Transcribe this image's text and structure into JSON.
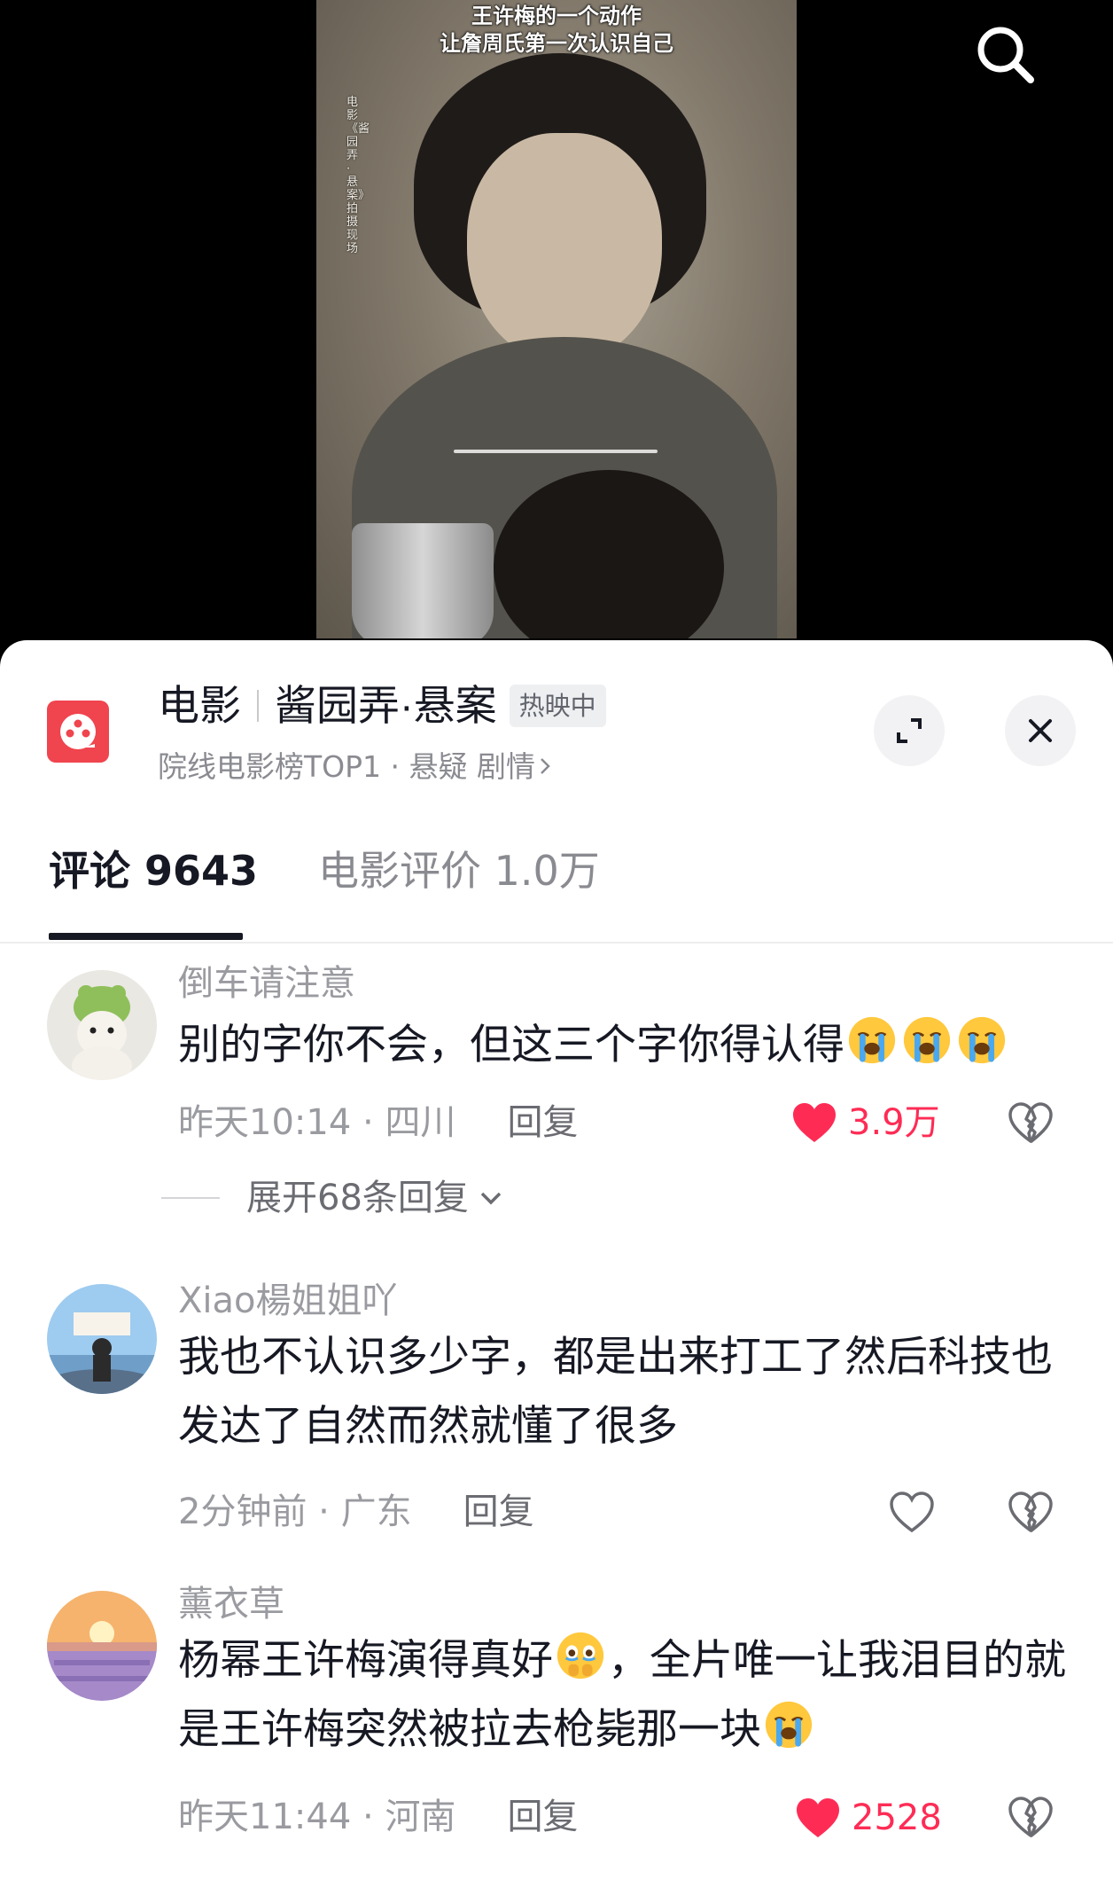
{
  "video": {
    "caption_line1": "王许梅的一个动作",
    "caption_line2": "让詹周氏第一次认识自己",
    "side_text": "电影《酱园弄·悬案》拍摄现场"
  },
  "movie": {
    "category": "电影",
    "name": "酱园弄·悬案",
    "badge": "热映中",
    "subtitle": "院线电影榜TOP1 · 悬疑 剧情",
    "logo_color": "#F0444E"
  },
  "tabs": {
    "comments": "评论 9643",
    "reviews": "电影评价 1.0万"
  },
  "comments": [
    {
      "user": "倒车请注意",
      "text": "别的字你不会，但这三个字你得认得",
      "emojis": [
        "crying-face",
        "crying-face",
        "crying-face"
      ],
      "time": "昨天10:14",
      "location": "四川",
      "reply_label": "回复",
      "likes": "3.9万",
      "liked": true,
      "expand_label": "展开68条回复"
    },
    {
      "user": "Xiao楊姐姐吖",
      "text": "我也不认识多少字，都是出来打工了然后科技也发达了自然而然就懂了很多",
      "time": "2分钟前",
      "location": "广东",
      "reply_label": "回复",
      "liked": false
    },
    {
      "user": "薰衣草",
      "text_part1": "杨幂王许梅演得真好",
      "text_part2": "，全片唯一让我泪目的就是王许梅突然被拉去枪毙那一块",
      "emojis": [
        "holding-back-tears-face",
        "crying-face"
      ],
      "time": "昨天11:44",
      "location": "河南",
      "reply_label": "回复",
      "likes": "2528",
      "liked": true
    }
  ],
  "colors": {
    "like_red": "#FE2C55",
    "text_primary": "#161823",
    "text_secondary": "#9A9BA0"
  }
}
